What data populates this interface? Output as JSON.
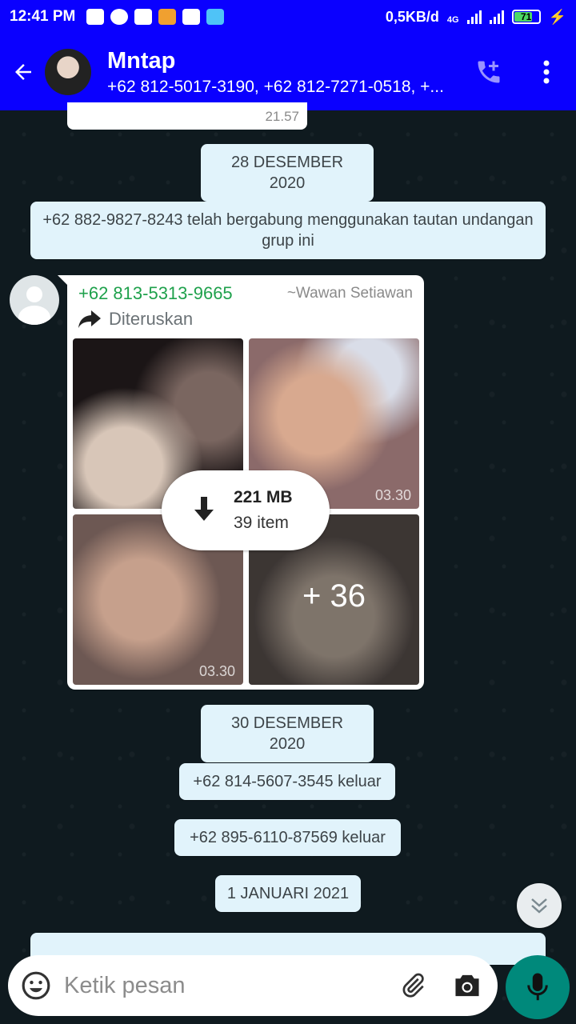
{
  "status_bar": {
    "time": "12:41 PM",
    "speed": "0,5KB/d",
    "network": "4G",
    "battery": "71"
  },
  "header": {
    "title": "Mntap",
    "subtitle": "+62 812-5017-3190, +62 812-7271-0518, +..."
  },
  "messages": {
    "prev_time": "21.57",
    "date1": "28 DESEMBER 2020",
    "join_notice": "+62 882-9827-8243 telah bergabung menggunakan tautan undangan grup ini",
    "media": {
      "sender": "+62 813-5313-9665",
      "pushname": "~Wawan Setiawan",
      "forwarded": "Diteruskan",
      "duration_a": "03.30",
      "duration_b": "03.30",
      "more": "+ 36",
      "download_size": "221 MB",
      "item_count": "39 item"
    },
    "date2": "30 DESEMBER 2020",
    "left1": "+62 814-5607-3545 keluar",
    "left2": "+62 895-6110-87569 keluar",
    "date3": "1 JANUARI 2021"
  },
  "input": {
    "placeholder": "Ketik pesan"
  },
  "colors": {
    "app_bar": "#0a00ff",
    "mic_button": "#00897b",
    "sender_name": "#1fa14c"
  }
}
